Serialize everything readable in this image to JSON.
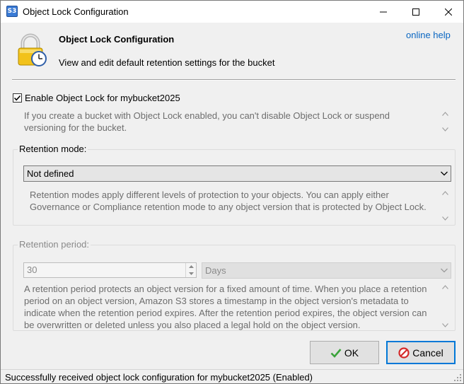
{
  "window": {
    "title": "Object Lock Configuration",
    "app_icon_text": "S3",
    "controls": [
      "minimize-icon",
      "maximize-icon",
      "close-icon"
    ]
  },
  "header": {
    "title": "Object Lock Configuration",
    "subtitle": "View and edit default retention settings for the bucket",
    "help_link": "online help",
    "icon": "lock-clock-icon"
  },
  "enable": {
    "checked": true,
    "label": "Enable Object Lock for mybucket2025",
    "info_line1": "If you create a bucket with Object Lock enabled, you can't disable Object Lock or suspend",
    "info_line2": "versioning for the bucket."
  },
  "retention_mode": {
    "legend": "Retention mode:",
    "selected": "Not defined",
    "info_line1": "Retention modes apply different levels of protection to your objects. You can apply either",
    "info_line2": "Governance or Compliance retention mode to any object version that is protected by Object Lock."
  },
  "retention_period": {
    "legend": "Retention period:",
    "value": "30",
    "unit": "Days",
    "info_line1": "A retention period protects an object version for a fixed amount of time. When you place a retention",
    "info_line2": "period on an object version, Amazon S3 stores a timestamp in the object version's metadata to",
    "info_line3": "indicate when the retention period expires. After the retention period expires, the object version can",
    "info_line4": "be overwritten or deleted unless you also placed a legal hold on the object version."
  },
  "buttons": {
    "ok": "OK",
    "cancel": "Cancel"
  },
  "status": {
    "text": "Successfully received object lock configuration for mybucket2025 (Enabled)"
  },
  "colors": {
    "link": "#0a66c2",
    "focus_border": "#0078d7",
    "disabled_text": "#6d6d6d",
    "ok_check": "#3aa33a",
    "cancel_icon": "#d42a2a",
    "lock_body": "#f2c21b"
  }
}
